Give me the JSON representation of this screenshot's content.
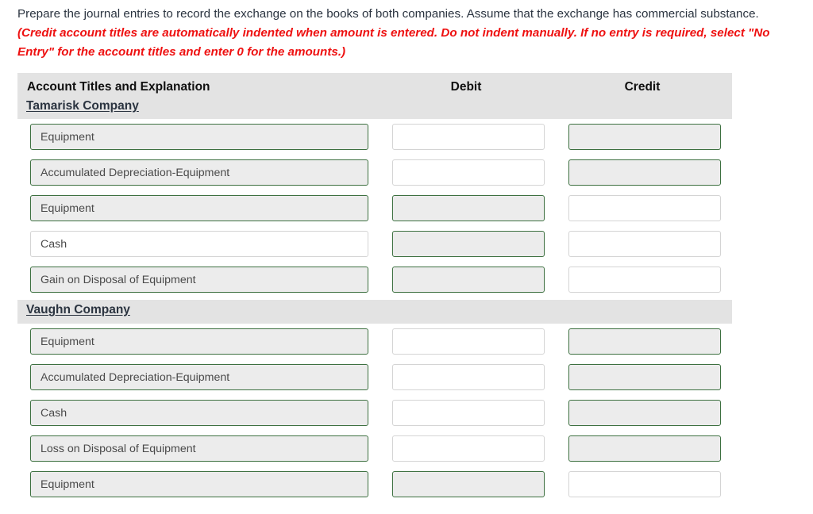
{
  "instructions": {
    "main": "Prepare the journal entries to record the exchange on the books of both companies. Assume that the exchange has commercial substance. ",
    "hint": "(Credit account titles are automatically indented when amount is entered. Do not indent manually. If no entry is required, select \"No Entry\" for the account titles and enter 0 for the amounts.)"
  },
  "table": {
    "columns": {
      "account": "Account Titles and Explanation",
      "debit": "Debit",
      "credit": "Credit"
    },
    "sections": [
      {
        "company": "Tamarisk Company",
        "rows": [
          {
            "account": "Equipment",
            "account_state": "state-filled",
            "debit": "",
            "debit_state": "state-empty",
            "credit": "",
            "credit_state": "state-filled"
          },
          {
            "account": "Accumulated Depreciation-Equipment",
            "account_state": "state-filled",
            "debit": "",
            "debit_state": "state-empty",
            "credit": "",
            "credit_state": "state-filled"
          },
          {
            "account": "Equipment",
            "account_state": "state-filled",
            "debit": "",
            "debit_state": "state-filled",
            "credit": "",
            "credit_state": "state-empty"
          },
          {
            "account": "Cash",
            "account_state": "state-empty",
            "debit": "",
            "debit_state": "state-filled",
            "credit": "",
            "credit_state": "state-empty"
          },
          {
            "account": "Gain on Disposal of Equipment",
            "account_state": "state-filled",
            "debit": "",
            "debit_state": "state-filled",
            "credit": "",
            "credit_state": "state-empty"
          }
        ]
      },
      {
        "company": "Vaughn Company",
        "rows": [
          {
            "account": "Equipment",
            "account_state": "state-filled",
            "debit": "",
            "debit_state": "state-empty",
            "credit": "",
            "credit_state": "state-filled"
          },
          {
            "account": "Accumulated Depreciation-Equipment",
            "account_state": "state-filled",
            "debit": "",
            "debit_state": "state-empty",
            "credit": "",
            "credit_state": "state-filled"
          },
          {
            "account": "Cash",
            "account_state": "state-filled",
            "debit": "",
            "debit_state": "state-empty",
            "credit": "",
            "credit_state": "state-filled"
          },
          {
            "account": "Loss on Disposal of Equipment",
            "account_state": "state-filled",
            "debit": "",
            "debit_state": "state-empty",
            "credit": "",
            "credit_state": "state-filled"
          },
          {
            "account": "Equipment",
            "account_state": "state-filled",
            "debit": "",
            "debit_state": "state-filled",
            "credit": "",
            "credit_state": "state-empty"
          }
        ]
      }
    ]
  },
  "colors": {
    "accent_green": "#3d7040",
    "hint_red": "#ee1111",
    "band_gray": "#e3e3e3",
    "field_fill": "#ececec"
  }
}
